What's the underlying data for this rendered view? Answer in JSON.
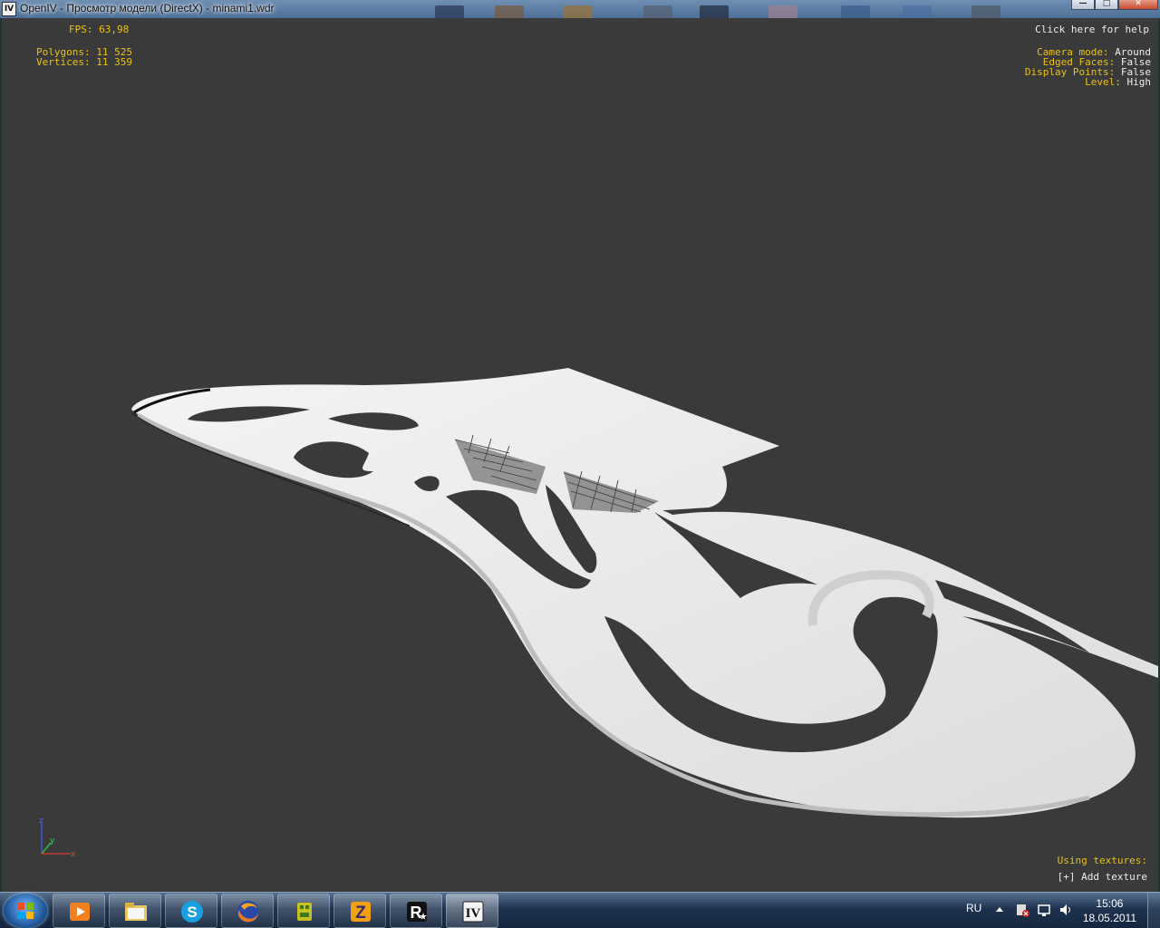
{
  "window": {
    "title": "OpenIV - Просмотр модели (DirectX) - minami1.wdr",
    "app_icon_text": "IV",
    "buttons": [
      "minimize-icon",
      "maximize-icon",
      "close-icon"
    ]
  },
  "hud": {
    "fps": "FPS: 63,98",
    "polygons": "Polygons: 11 525",
    "vertices": "Vertices: 11 359",
    "help": "Click here for help",
    "settings": [
      {
        "label": "Camera mode:",
        "value": "Around"
      },
      {
        "label": "Edged Faces:",
        "value": "False"
      },
      {
        "label": "Display Points:",
        "value": "False"
      },
      {
        "label": "Level:",
        "value": "High"
      }
    ],
    "using_textures": "Using textures:",
    "add_texture": "[+] Add texture"
  },
  "axis": {
    "z": "z",
    "y": "y",
    "x": "x"
  },
  "colors": {
    "viewport_bg": "#3a3a3a",
    "hud_yellow": "#e8c21a",
    "hud_white": "#ededed",
    "model": "#e6e6e6"
  },
  "taskbar": {
    "apps": [
      "media-player-icon",
      "explorer-icon",
      "skype-icon",
      "firefox-icon",
      "app-icon",
      "zona-icon",
      "rockstar-icon",
      "openiv-icon"
    ],
    "language": "RU",
    "time": "15:06",
    "date": "18.05.2011"
  }
}
